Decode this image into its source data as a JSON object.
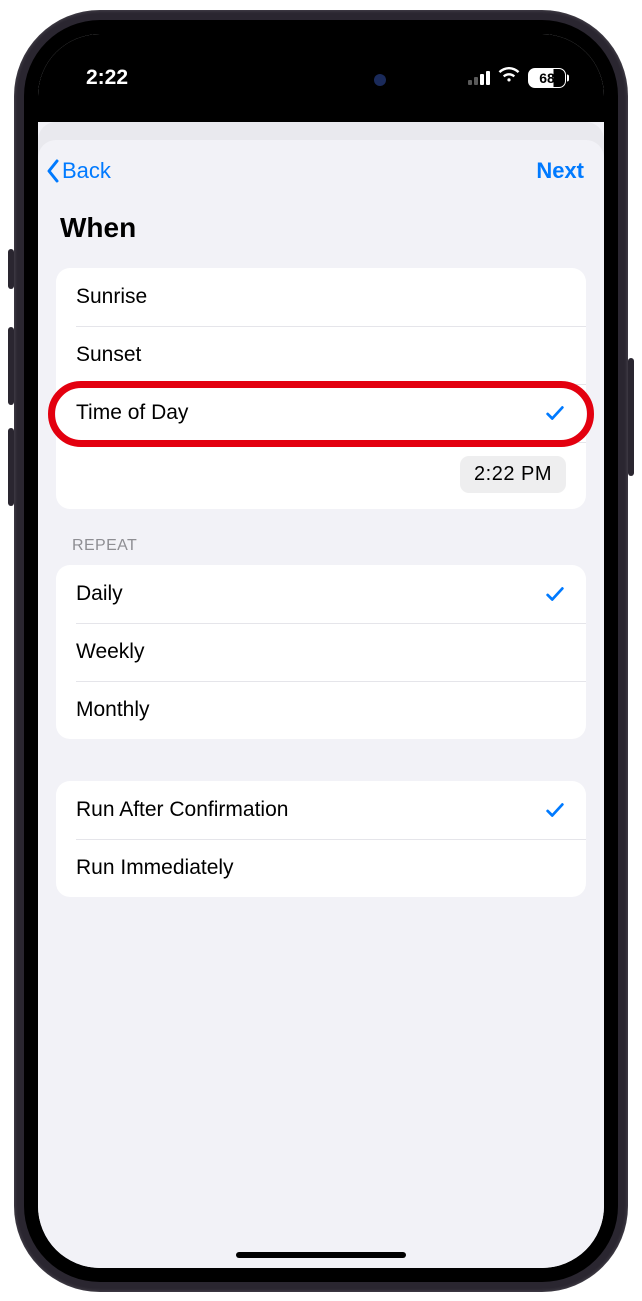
{
  "status": {
    "time": "2:22",
    "battery": "68"
  },
  "nav": {
    "back_label": "Back",
    "next_label": "Next"
  },
  "page": {
    "title": "When"
  },
  "when": {
    "options": [
      {
        "label": "Sunrise",
        "selected": false
      },
      {
        "label": "Sunset",
        "selected": false
      },
      {
        "label": "Time of Day",
        "selected": true
      }
    ],
    "time_value": "2:22 PM"
  },
  "repeat": {
    "header": "REPEAT",
    "options": [
      {
        "label": "Daily",
        "selected": true
      },
      {
        "label": "Weekly",
        "selected": false
      },
      {
        "label": "Monthly",
        "selected": false
      }
    ]
  },
  "run": {
    "options": [
      {
        "label": "Run After Confirmation",
        "selected": true
      },
      {
        "label": "Run Immediately",
        "selected": false
      }
    ]
  },
  "colors": {
    "accent": "#007aff",
    "highlight": "#e3000f",
    "background": "#f2f2f7"
  }
}
